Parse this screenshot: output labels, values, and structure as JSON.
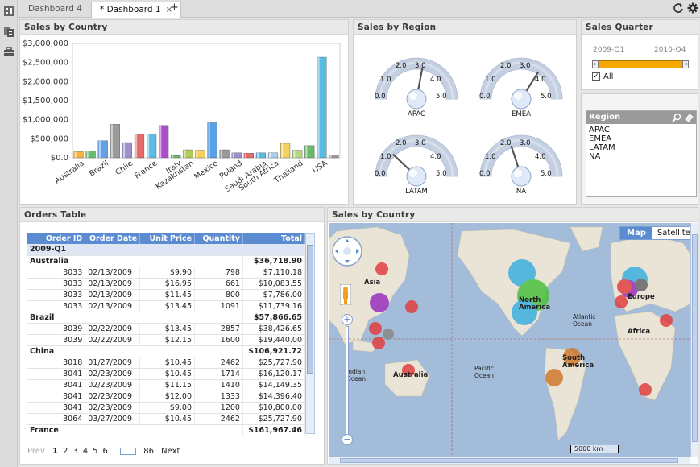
{
  "tabs": [
    {
      "label": "Dashboard 4",
      "active": false
    },
    {
      "label": "* Dashboard 1",
      "active": true
    }
  ],
  "tab_close": "×",
  "add_tab": "+",
  "panels": {
    "sales_by_country_chart": "Sales by Country",
    "sales_by_region": "Sales by Region",
    "sales_quarter": "Sales Quarter",
    "orders_table": "Orders Table",
    "sales_by_country_map": "Sales by Country"
  },
  "chart_data": {
    "type": "bar",
    "title": "Sales by Country",
    "categories": [
      "Australia",
      "",
      "Brazil",
      "",
      "Chile",
      "",
      "France",
      "",
      "Italy",
      "Kazakhstan",
      "",
      "Mexico",
      "",
      "Poland",
      "",
      "Saudi Arabia",
      "South Africa",
      "",
      "Thailand",
      "",
      "USA",
      ""
    ],
    "category_labels": [
      "Australia",
      "Brazil",
      "Chile",
      "France",
      "Italy",
      "Kazakhstan",
      "Mexico",
      "Poland",
      "Saudi Arabia",
      "South Africa",
      "Thailand",
      "USA"
    ],
    "values": [
      160000,
      180000,
      450000,
      880000,
      400000,
      620000,
      630000,
      850000,
      60000,
      210000,
      200000,
      920000,
      210000,
      130000,
      120000,
      130000,
      130000,
      380000,
      200000,
      320000,
      2640000,
      80000
    ],
    "colors": [
      "#f5a623",
      "#4caf50",
      "#4a8fe0",
      "#888888",
      "#8e7cc3",
      "#e05050",
      "#3cb0e0",
      "#9b30c0",
      "#4caf50",
      "#a8c23a",
      "#f5c842",
      "#3c8fe0",
      "#888888",
      "#8e7cc3",
      "#e05050",
      "#3cb0e0",
      "#9bc8e8",
      "#f5c842",
      "#a8d06a",
      "#4caf50",
      "#3cb0e0",
      "#888888"
    ],
    "yticks": [
      "$3,000,000",
      "$2,500,000",
      "$2,000,000",
      "$1,500,000",
      "$1,000,000",
      "$500,000",
      "$0.0"
    ],
    "ylim": [
      0,
      3000000
    ],
    "grid": false
  },
  "gauges": [
    {
      "name": "APAC",
      "value": 2.8
    },
    {
      "name": "EMEA",
      "value": 3.4
    },
    {
      "name": "LATAM",
      "value": 1.2
    },
    {
      "name": "NA",
      "value": 2.0
    }
  ],
  "gauge_ticks": {
    "t0": "0.0",
    "t1": "1.0",
    "t2": "2.0",
    "t3": "3.0",
    "t4": "4.0",
    "t5": "5.0"
  },
  "gauge_max": 5.0,
  "quarter": {
    "start": "2009-Q1",
    "end": "2010-Q4",
    "all_label": "All",
    "all_checked": true
  },
  "region": {
    "header": "Region",
    "items": [
      "APAC",
      "EMEA",
      "LATAM",
      "NA"
    ]
  },
  "orders": {
    "columns": [
      "Order ID",
      "Order Date",
      "Unit Price",
      "Quantity",
      "Total"
    ],
    "group": "2009-Q1",
    "rows": [
      {
        "type": "cty",
        "name": "Australia",
        "total": "$36,718.90"
      },
      {
        "type": "row",
        "id": "3033",
        "date": "02/13/2009",
        "price": "$9.90",
        "qty": "798",
        "total": "$7,110.18"
      },
      {
        "type": "row",
        "id": "3033",
        "date": "02/13/2009",
        "price": "$16.95",
        "qty": "661",
        "total": "$10,083.55"
      },
      {
        "type": "row",
        "id": "3033",
        "date": "02/13/2009",
        "price": "$11.45",
        "qty": "800",
        "total": "$7,786.00"
      },
      {
        "type": "row",
        "id": "3033",
        "date": "02/13/2009",
        "price": "$13.45",
        "qty": "1091",
        "total": "$11,739.16"
      },
      {
        "type": "cty",
        "name": "Brazil",
        "total": "$57,866.65"
      },
      {
        "type": "row",
        "id": "3039",
        "date": "02/22/2009",
        "price": "$13.45",
        "qty": "2857",
        "total": "$38,426.65"
      },
      {
        "type": "row",
        "id": "3039",
        "date": "02/22/2009",
        "price": "$12.15",
        "qty": "1600",
        "total": "$19,440.00"
      },
      {
        "type": "cty",
        "name": "China",
        "total": "$106,921.72"
      },
      {
        "type": "row",
        "id": "3018",
        "date": "01/27/2009",
        "price": "$10.45",
        "qty": "2462",
        "total": "$25,727.90"
      },
      {
        "type": "row",
        "id": "3041",
        "date": "02/23/2009",
        "price": "$10.45",
        "qty": "1714",
        "total": "$16,120.17"
      },
      {
        "type": "row",
        "id": "3041",
        "date": "02/23/2009",
        "price": "$11.15",
        "qty": "1410",
        "total": "$14,149.35"
      },
      {
        "type": "row",
        "id": "3041",
        "date": "02/23/2009",
        "price": "$12.00",
        "qty": "1333",
        "total": "$14,396.40"
      },
      {
        "type": "row",
        "id": "3041",
        "date": "02/23/2009",
        "price": "$9.00",
        "qty": "1200",
        "total": "$10,800.00"
      },
      {
        "type": "row",
        "id": "3064",
        "date": "03/27/2009",
        "price": "$10.45",
        "qty": "2462",
        "total": "$25,727.90"
      },
      {
        "type": "cty",
        "name": "France",
        "total": "$161,967.46"
      }
    ]
  },
  "pager": {
    "prev": "Prev",
    "pages": [
      "1",
      "2",
      "3",
      "4",
      "5",
      "6"
    ],
    "last": "86",
    "next": "Next"
  },
  "map": {
    "btn_map": "Map",
    "btn_satellite": "Satellite",
    "labels": [
      "Asia",
      "North America",
      "Atlantic Ocean",
      "Europe",
      "Africa",
      "Indian Ocean",
      "Australia",
      "Pacific Ocean",
      "South America"
    ],
    "scale": "5000 km"
  }
}
